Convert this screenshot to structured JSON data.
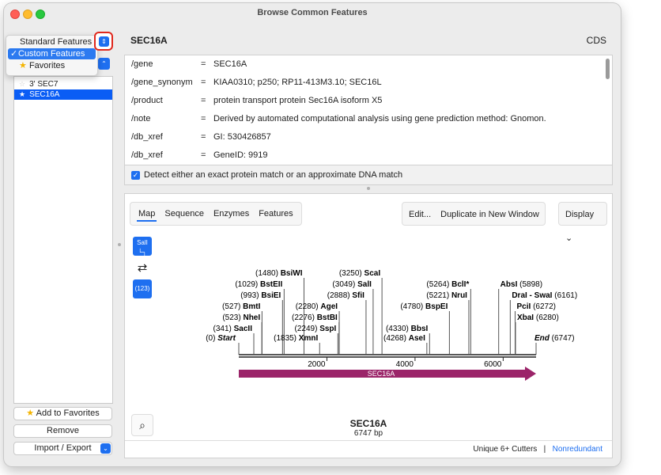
{
  "window": {
    "title": "Browse Common Features"
  },
  "dropdown": {
    "items": [
      {
        "label": "Standard Features",
        "selected": false
      },
      {
        "label": "Custom Features",
        "selected": true
      },
      {
        "label": "Favorites",
        "selected": false
      }
    ],
    "check": "✓"
  },
  "sidebar": {
    "list": [
      {
        "label": "3' SEC7",
        "selected": false
      },
      {
        "label": "SEC16A",
        "selected": true
      }
    ],
    "add_favorites": "Add to Favorites",
    "remove": "Remove",
    "import_export": "Import / Export"
  },
  "feature": {
    "name": "SEC16A",
    "type": "CDS",
    "qualifiers": [
      {
        "key": "/gene",
        "eq": "=",
        "value": "SEC16A"
      },
      {
        "key": "/gene_synonym",
        "eq": "=",
        "value": "KIAA0310; p250; RP11-413M3.10; SEC16L"
      },
      {
        "key": "/product",
        "eq": "=",
        "value": "protein transport protein Sec16A isoform X5"
      },
      {
        "key": "/note",
        "eq": "=",
        "value": "Derived by automated computational analysis using gene prediction method: Gnomon."
      },
      {
        "key": "/db_xref",
        "eq": "=",
        "value": "GI: 530426857"
      },
      {
        "key": "/db_xref",
        "eq": "=",
        "value": "GeneID: 9919"
      }
    ],
    "detect_label": "Detect either an exact protein match or an approximate DNA match"
  },
  "map": {
    "tabs": [
      "Map",
      "Sequence",
      "Enzymes",
      "Features"
    ],
    "edit": "Edit...",
    "duplicate": "Duplicate in New Window",
    "display": "Display",
    "tool_sali": "SalI",
    "tool_123": "(123)",
    "seq_name": "SEC16A",
    "seq_length": "6747 bp",
    "footer_cutters": "Unique 6+ Cutters",
    "footer_sep": "|",
    "footer_link": "Nonredundant",
    "feature_label": "SEC16A",
    "feature_color": "#9b2469",
    "total_bp": 6747,
    "ticks": [
      {
        "pos": 2000,
        "label": "2000"
      },
      {
        "pos": 4000,
        "label": "4000"
      },
      {
        "pos": 6000,
        "label": "6000"
      }
    ],
    "start_label": {
      "num": "(0)",
      "name": "Start"
    },
    "end_label": {
      "num": "(6747)",
      "name": "End"
    },
    "sites": [
      {
        "num": "(341)",
        "name": "SacII",
        "pos": 341,
        "row": 0,
        "side": "left"
      },
      {
        "num": "(523)",
        "name": "NheI",
        "pos": 523,
        "row": 1,
        "side": "left"
      },
      {
        "num": "(527)",
        "name": "BmtI",
        "pos": 527,
        "row": 2,
        "side": "left"
      },
      {
        "num": "(993)",
        "name": "BsiEI",
        "pos": 993,
        "row": 3,
        "side": "left"
      },
      {
        "num": "(1029)",
        "name": "BstEII",
        "pos": 1029,
        "row": 4,
        "side": "left"
      },
      {
        "num": "(1480)",
        "name": "BsiWI",
        "pos": 1480,
        "row": 5,
        "side": "left"
      },
      {
        "num": "(1835)",
        "name": "XmnI",
        "pos": 1835,
        "row": -1,
        "side": "left"
      },
      {
        "num": "(2249)",
        "name": "SspI",
        "pos": 2249,
        "row": 0,
        "side": "left"
      },
      {
        "num": "(2276)",
        "name": "BstBI",
        "pos": 2276,
        "row": 1,
        "side": "left"
      },
      {
        "num": "(2280)",
        "name": "AgeI",
        "pos": 2280,
        "row": 2,
        "side": "left"
      },
      {
        "num": "(2888)",
        "name": "SfiI",
        "pos": 2888,
        "row": 3,
        "side": "left"
      },
      {
        "num": "(3049)",
        "name": "SalI",
        "pos": 3049,
        "row": 4,
        "side": "left"
      },
      {
        "num": "(3250)",
        "name": "ScaI",
        "pos": 3250,
        "row": 5,
        "side": "left"
      },
      {
        "num": "(4268)",
        "name": "AseI",
        "pos": 4268,
        "row": -1,
        "side": "left"
      },
      {
        "num": "(4330)",
        "name": "BbsI",
        "pos": 4330,
        "row": 0,
        "side": "left"
      },
      {
        "num": "(4780)",
        "name": "BspEI",
        "pos": 4780,
        "row": 2,
        "side": "left"
      },
      {
        "num": "(5221)",
        "name": "NruI",
        "pos": 5221,
        "row": 3,
        "side": "left"
      },
      {
        "num": "(5264)",
        "name": "BclI*",
        "pos": 5264,
        "row": 4,
        "side": "left"
      },
      {
        "num": "(5898)",
        "name": "AbsI",
        "pos": 5898,
        "row": 4,
        "side": "right"
      },
      {
        "num": "(6161)",
        "name": "DraI - SwaI",
        "pos": 6161,
        "row": 3,
        "side": "right"
      },
      {
        "num": "(6272)",
        "name": "PciI",
        "pos": 6272,
        "row": 2,
        "side": "right"
      },
      {
        "num": "(6280)",
        "name": "XbaI",
        "pos": 6280,
        "row": 1,
        "side": "right"
      }
    ]
  }
}
